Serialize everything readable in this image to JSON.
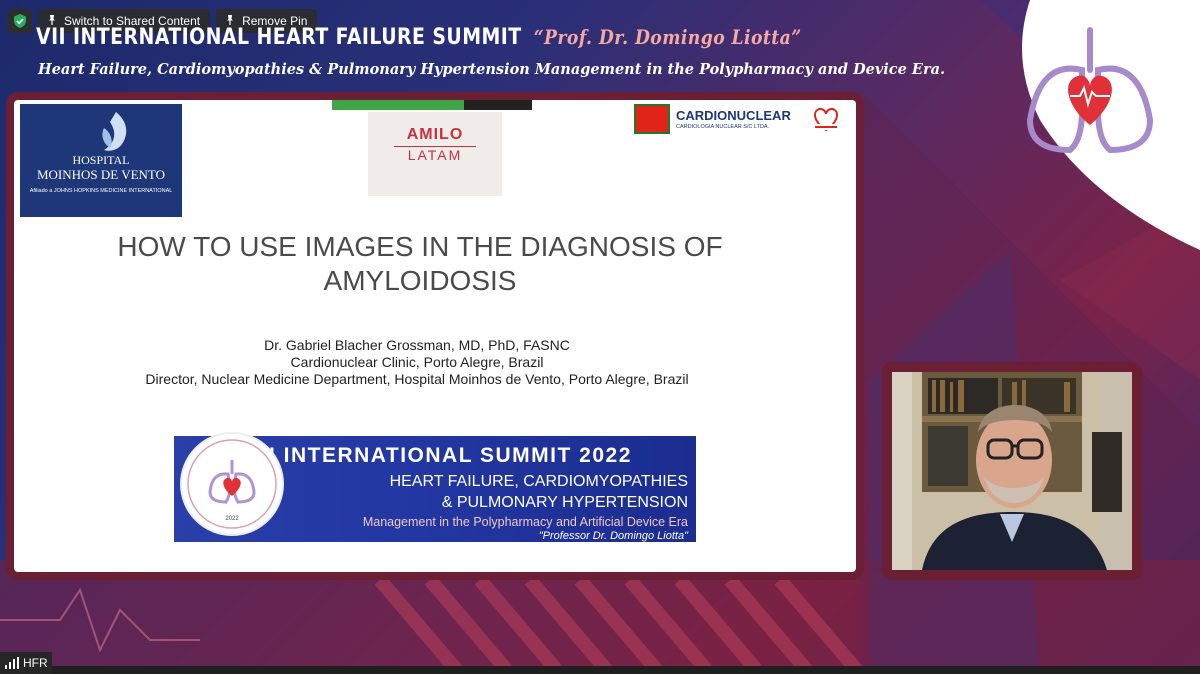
{
  "toolbar": {
    "switch_label": "Switch to Shared Content",
    "remove_pin_label": "Remove Pin"
  },
  "header": {
    "title": "VII INTERNATIONAL HEART FAILURE SUMMIT",
    "honoree": "“Prof. Dr. Domingo Liotta”",
    "subtitle": "Heart Failure, Cardiomyopathies & Pulmonary Hypertension Management in the Polypharmacy and Device Era."
  },
  "slide": {
    "hospital_logo": {
      "line1": "HOSPITAL",
      "line2": "MOINHOS DE VENTO",
      "affiliation": "Afiliado a JOHNS HOPKINS MEDICINE INTERNATIONAL"
    },
    "amilo_logo": {
      "line1": "AMILO",
      "line2": "LATAM"
    },
    "cardionuclear_logo": {
      "name": "CARDIONUCLEAR",
      "subtitle": "CARDIOLOGIA NUCLEAR S/C LTDA."
    },
    "title_line1": "HOW TO USE IMAGES IN THE DIAGNOSIS OF",
    "title_line2": "AMYLOIDOSIS",
    "author_line1": "Dr. Gabriel Blacher Grossman, MD, PhD, FASNC",
    "author_line2": "Cardionuclear Clinic, Porto Alegre, Brazil",
    "author_line3": "Director, Nuclear Medicine Department, Hospital Moinhos de Vento, Porto Alegre, Brazil",
    "banner": {
      "line1": "VII INTERNATIONAL SUMMIT 2022",
      "line2": "HEART FAILURE, CARDIOMYOPATHIES",
      "line3": "& PULMONARY HYPERTENSION",
      "line4": "Management in the Polypharmacy and Artificial Device Era",
      "line5": "\"Professor Dr. Domingo Liotta\""
    },
    "seal_year": "2022"
  },
  "status": {
    "label": "HFR"
  },
  "colors": {
    "frame": "#6b1f34",
    "banner_blue": "#2438a4",
    "hospital_blue": "#1d3778",
    "accent_red": "#e2231a"
  }
}
